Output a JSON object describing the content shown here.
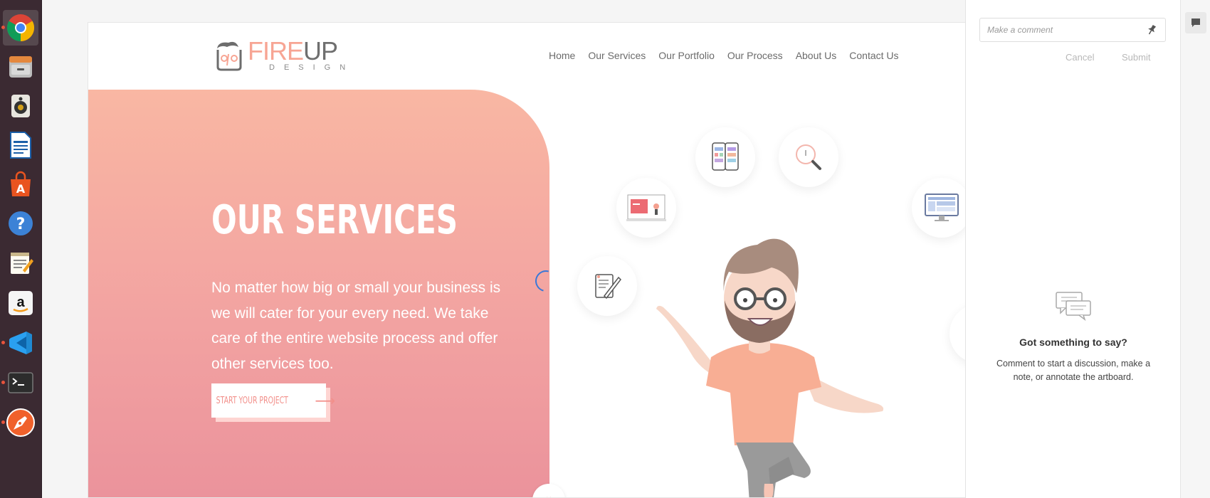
{
  "launcher": {
    "items": [
      {
        "name": "chrome",
        "icon": "chrome-icon",
        "active": true,
        "running": true
      },
      {
        "name": "file-manager",
        "icon": "file-cabinet-icon",
        "active": false,
        "running": false
      },
      {
        "name": "speaker",
        "icon": "speaker-icon",
        "active": false,
        "running": false
      },
      {
        "name": "writer",
        "icon": "document-icon",
        "active": false,
        "running": false
      },
      {
        "name": "software-center",
        "icon": "shopping-bag-icon",
        "active": false,
        "running": false
      },
      {
        "name": "help",
        "icon": "help-icon",
        "active": false,
        "running": false
      },
      {
        "name": "text-editor",
        "icon": "notepad-icon",
        "active": false,
        "running": false
      },
      {
        "name": "amazon",
        "icon": "amazon-icon",
        "active": false,
        "running": false
      },
      {
        "name": "vscode",
        "icon": "vscode-icon",
        "active": false,
        "running": true
      },
      {
        "name": "terminal",
        "icon": "terminal-icon",
        "active": false,
        "running": true
      },
      {
        "name": "pen-tool",
        "icon": "pen-nib-icon",
        "active": false,
        "running": true
      }
    ]
  },
  "site": {
    "logo": {
      "fire": "FIRE",
      "up": "UP",
      "sub": "DESIGN"
    },
    "nav": [
      "Home",
      "Our Services",
      "Our Portfolio",
      "Our Process",
      "About Us",
      "Contact Us"
    ],
    "hero": {
      "title": "OUR SERVICES",
      "text": "No matter how big or small your business is we will cater for your every need. We take care of the entire website process and offer other services too.",
      "cta": "START YOUR PROJECT"
    }
  },
  "comments": {
    "placeholder": "Make a comment",
    "cancel": "Cancel",
    "submit": "Submit",
    "empty_title": "Got something to say?",
    "empty_text": "Comment to start a discussion, make a note, or annotate the artboard."
  },
  "colors": {
    "brand_peach": "#f7a594",
    "brand_pink": "#ea919b",
    "launcher_bg": "#3b2a32",
    "spinner_blue": "#3a78d8"
  }
}
